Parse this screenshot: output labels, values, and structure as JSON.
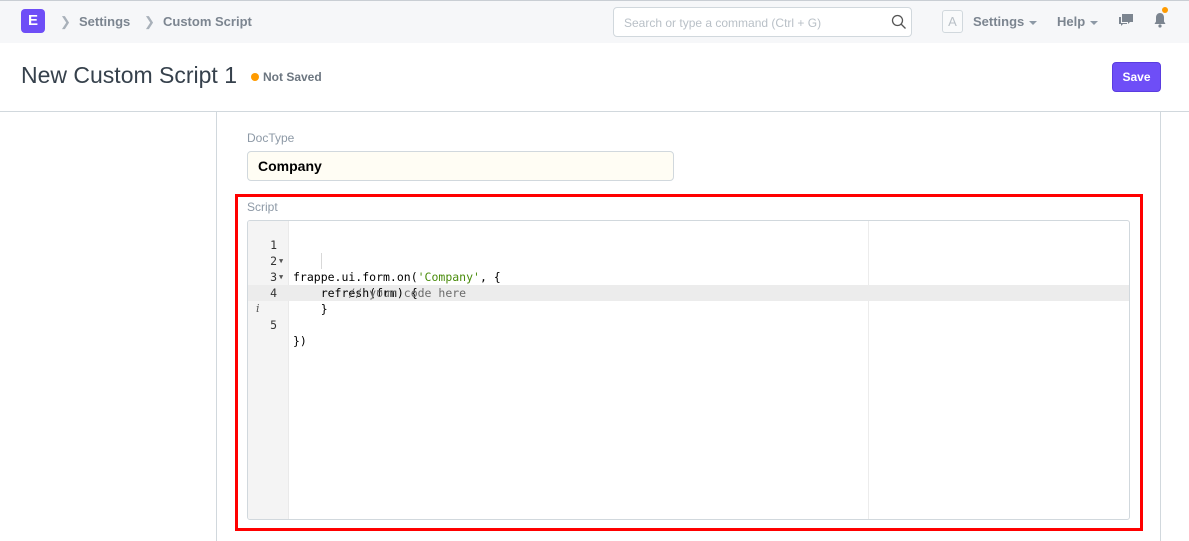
{
  "navbar": {
    "logo_letter": "E",
    "breadcrumbs": [
      "Settings",
      "Custom Script"
    ],
    "search_placeholder": "Search or type a command (Ctrl + G)",
    "avatar_initial": "A",
    "menus": [
      "Settings",
      "Help"
    ],
    "notification_dot_color": "#ff9b00"
  },
  "page": {
    "title": "New Custom Script 1",
    "status": "Not Saved",
    "status_color": "#ff9b00",
    "save_label": "Save",
    "accent_color": "#6e4ef7"
  },
  "form": {
    "doctype_label": "DocType",
    "doctype_value": "Company",
    "script_label": "Script"
  },
  "editor": {
    "lines": [
      {
        "num": "1",
        "fold": true,
        "code_before": "frappe.ui.form.on(",
        "string": "'Company'",
        "code_after": ", {"
      },
      {
        "num": "2",
        "fold": true,
        "code": "    refresh(frm) {"
      },
      {
        "num": "3",
        "fold": false,
        "comment": "        // your code here"
      },
      {
        "num": "4",
        "fold": false,
        "code": "    }"
      },
      {
        "num": "5",
        "fold": false,
        "info": "i",
        "code": "})"
      }
    ]
  }
}
